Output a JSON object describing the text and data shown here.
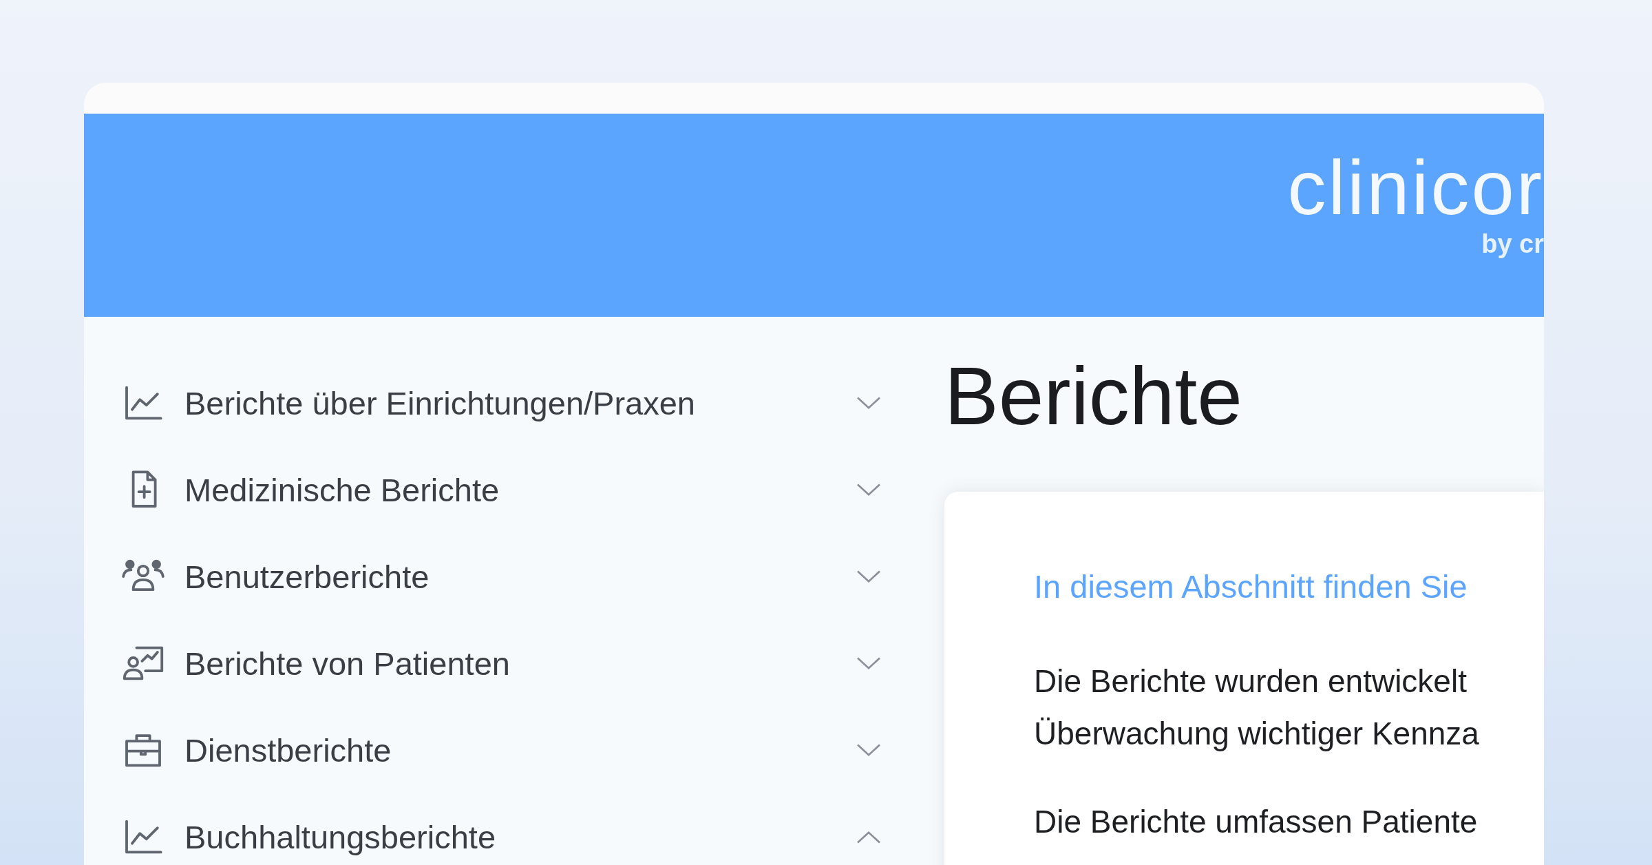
{
  "header": {
    "logo": "clinicor",
    "logo_tagline": "by cr"
  },
  "sidebar": {
    "items": [
      {
        "label": "Berichte über Einrichtungen/Praxen",
        "kind": "chart",
        "expanded": false
      },
      {
        "label": "Medizinische Berichte",
        "kind": "document",
        "expanded": false
      },
      {
        "label": "Benutzerberichte",
        "kind": "users",
        "expanded": false
      },
      {
        "label": "Berichte von Patienten",
        "kind": "patient",
        "expanded": false
      },
      {
        "label": "Dienstberichte",
        "kind": "briefcase",
        "expanded": false
      },
      {
        "label": "Buchhaltungsberichte",
        "kind": "chart",
        "expanded": true
      }
    ]
  },
  "main": {
    "title": "Berichte",
    "card": {
      "intro": "In diesem Abschnitt finden Sie",
      "paragraphs": [
        [
          "Die Berichte wurden entwickelt",
          "Überwachung wichtiger Kennza"
        ],
        [
          "Die Berichte umfassen Patiente"
        ]
      ]
    }
  }
}
